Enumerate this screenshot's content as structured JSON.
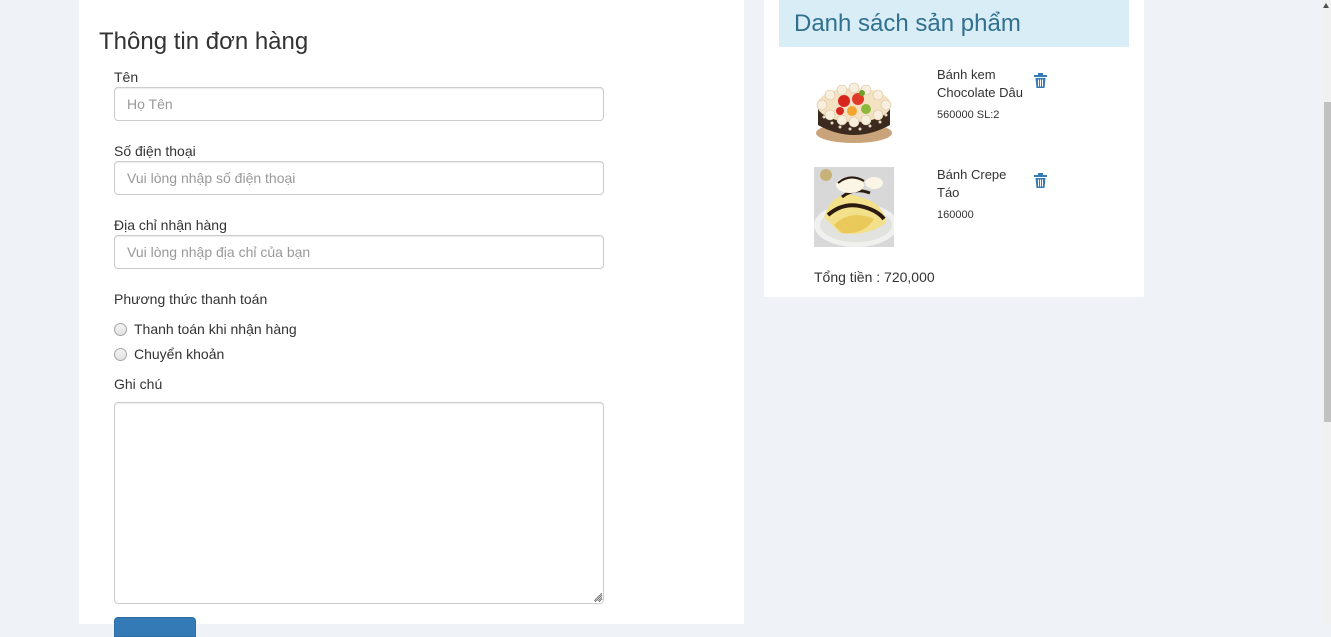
{
  "order_form": {
    "title": "Thông tin đơn hàng",
    "name_label": "Tên",
    "name_placeholder": "Họ Tên",
    "phone_label": "Số điện thoại",
    "phone_placeholder": "Vui lòng nhập số điện thoại",
    "address_label": "Địa chỉ nhận hàng",
    "address_placeholder": "Vui lòng nhập địa chỉ của bạn",
    "payment_label": "Phương thức thanh toán",
    "payment_options": [
      "Thanh toán khi nhận hàng",
      "Chuyển khoản"
    ],
    "notes_label": "Ghi chú"
  },
  "cart": {
    "title": "Danh sách sản phẩm",
    "items": [
      {
        "name": "Bánh kem Chocolate Dâu",
        "price_line": "560000 SL:2",
        "icon": "trash-icon"
      },
      {
        "name": "Bánh Crepe Táo",
        "price_line": "160000",
        "icon": "trash-icon"
      }
    ],
    "total": "Tổng tiền : 720,000"
  },
  "colors": {
    "primary": "#337ab7",
    "header_bg": "#d9edf7",
    "header_text": "#31708f",
    "page_bg": "#eff2f7"
  }
}
